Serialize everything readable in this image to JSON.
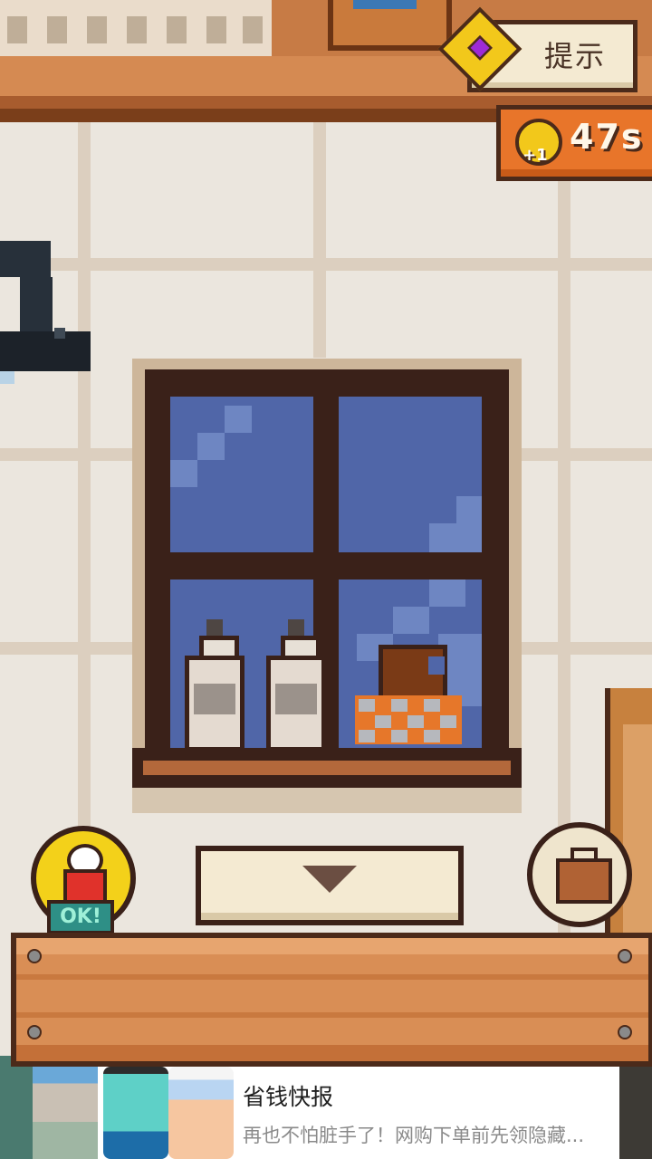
{
  "hud": {
    "hint_label": "提示",
    "timer_value": "47s",
    "timer_bonus": "+1"
  },
  "actions": {
    "capsule_status": "OK!",
    "arrow_icon": "triangle-down",
    "bag_icon": "briefcase"
  },
  "ad": {
    "title": "省钱快报",
    "description": "再也不怕脏手了！网购下单前先领隐藏..."
  },
  "colors": {
    "wall": "#ebe6de",
    "wood": "#d98e55",
    "window_glass": "#5066a8",
    "timer_bg": "#e8752a",
    "gem": "#f2c81b"
  }
}
